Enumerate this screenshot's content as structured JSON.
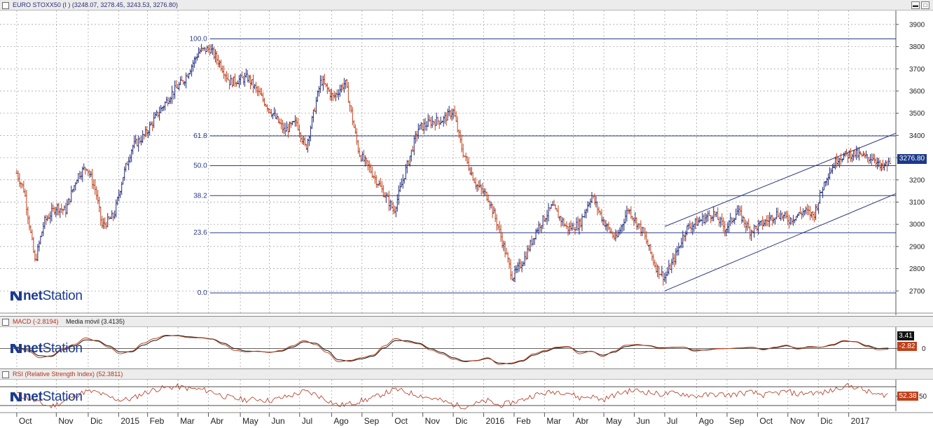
{
  "price_panel": {
    "title": "EURO STOXX50 (I ) (3248.07, 3278.45, 3243.53, 3276.80)",
    "last_value": "3276.80",
    "brand_prefix": "net",
    "brand_suffix": "Station"
  },
  "macd_panel": {
    "title": "MACD (-2.8194)",
    "subtitle": "Media móvil (3.4135)",
    "signal_value": "3.41",
    "macd_value": "-2.82"
  },
  "rsi_panel": {
    "title": "RSI (Relative Strength Index) (52.3811)",
    "rsi_value": "52.38"
  },
  "window_buttons": {
    "minimize": "▬",
    "maximize": "□"
  },
  "colors": {
    "up": "#1f2a7a",
    "down": "#c0401a",
    "grid": "#9a9a9a",
    "level_line": "#2c3a86",
    "signal_line": "#111111",
    "macd_line": "#c0401a",
    "rsi_line": "#b4331c",
    "last_price_box": "#1c3a8a"
  },
  "chart_data": [
    {
      "type": "line",
      "name_series": "EURO STOXX50 weekly OHLC",
      "ylim": [
        2600,
        3950
      ],
      "y_ticks": [
        2700,
        2800,
        2900,
        3000,
        3100,
        3200,
        3300,
        3400,
        3500,
        3600,
        3700,
        3800,
        3900
      ],
      "x_labels": [
        "Oct",
        "Nov",
        "Dic",
        "2015",
        "Feb",
        "Mar",
        "Abr",
        "May",
        "Jun",
        "Jul",
        "Ago",
        "Sep",
        "Oct",
        "Nov",
        "Dic",
        "2016",
        "Feb",
        "Mar",
        "Abr",
        "May",
        "Jun",
        "Jul",
        "Ago",
        "Sep",
        "Oct",
        "Nov",
        "Dic",
        "2017"
      ],
      "x_positions": [
        0,
        1.3,
        2.35,
        3.35,
        4.3,
        5.3,
        6.3,
        7.35,
        8.3,
        9.3,
        10.35,
        11.35,
        12.35,
        13.35,
        14.35,
        15.35,
        16.35,
        17.35,
        18.3,
        19.3,
        20.3,
        21.3,
        22.35,
        23.35,
        24.35,
        25.35,
        26.35,
        27.35
      ],
      "x_range": [
        -0.55,
        28.9
      ],
      "anchors": [
        [
          0.0,
          3230
        ],
        [
          0.25,
          3150
        ],
        [
          0.6,
          2830
        ],
        [
          0.9,
          3010
        ],
        [
          1.3,
          3080
        ],
        [
          1.6,
          3060
        ],
        [
          2.0,
          3220
        ],
        [
          2.3,
          3260
        ],
        [
          2.6,
          3150
        ],
        [
          2.8,
          2990
        ],
        [
          3.2,
          3040
        ],
        [
          3.5,
          3220
        ],
        [
          3.8,
          3350
        ],
        [
          4.2,
          3400
        ],
        [
          4.6,
          3490
        ],
        [
          5.1,
          3590
        ],
        [
          5.5,
          3650
        ],
        [
          6.0,
          3780
        ],
        [
          6.35,
          3790
        ],
        [
          6.7,
          3720
        ],
        [
          7.0,
          3640
        ],
        [
          7.6,
          3660
        ],
        [
          8.1,
          3560
        ],
        [
          8.8,
          3420
        ],
        [
          9.2,
          3460
        ],
        [
          9.5,
          3340
        ],
        [
          10.0,
          3650
        ],
        [
          10.4,
          3570
        ],
        [
          10.8,
          3640
        ],
        [
          11.25,
          3320
        ],
        [
          11.6,
          3250
        ],
        [
          11.9,
          3180
        ],
        [
          12.4,
          3060
        ],
        [
          12.8,
          3250
        ],
        [
          13.2,
          3430
        ],
        [
          13.6,
          3460
        ],
        [
          14.0,
          3470
        ],
        [
          14.35,
          3510
        ],
        [
          14.65,
          3330
        ],
        [
          15.1,
          3180
        ],
        [
          15.5,
          3120
        ],
        [
          15.8,
          3000
        ],
        [
          16.3,
          2760
        ],
        [
          16.7,
          2850
        ],
        [
          17.1,
          2980
        ],
        [
          17.6,
          3080
        ],
        [
          18.1,
          2980
        ],
        [
          18.5,
          3000
        ],
        [
          18.9,
          3130
        ],
        [
          19.3,
          3010
        ],
        [
          19.7,
          2930
        ],
        [
          20.1,
          3070
        ],
        [
          20.6,
          2960
        ],
        [
          21.0,
          2810
        ],
        [
          21.3,
          2760
        ],
        [
          21.6,
          2840
        ],
        [
          22.0,
          2980
        ],
        [
          22.5,
          3020
        ],
        [
          22.9,
          3050
        ],
        [
          23.3,
          2980
        ],
        [
          23.7,
          3060
        ],
        [
          24.1,
          2970
        ],
        [
          24.6,
          3010
        ],
        [
          25.0,
          3050
        ],
        [
          25.4,
          3020
        ],
        [
          25.9,
          3060
        ],
        [
          26.2,
          3040
        ],
        [
          26.6,
          3210
        ],
        [
          27.0,
          3300
        ],
        [
          27.5,
          3320
        ],
        [
          27.9,
          3300
        ],
        [
          28.2,
          3300
        ],
        [
          28.4,
          3250
        ],
        [
          28.7,
          3276
        ]
      ],
      "fib_levels": [
        {
          "label": "100.0",
          "value": 3835
        },
        {
          "label": "61.8",
          "value": 3398
        },
        {
          "label": "50.0",
          "value": 3264
        },
        {
          "label": "38.2",
          "value": 3129
        },
        {
          "label": "23.6",
          "value": 2962
        },
        {
          "label": "0.0",
          "value": 2691
        }
      ],
      "fib_x_start": 6.35,
      "channel": [
        {
          "x1": 21.3,
          "y1": 2990,
          "x2": 28.9,
          "y2": 3410
        },
        {
          "x1": 21.3,
          "y1": 2700,
          "x2": 28.9,
          "y2": 3138
        }
      ]
    },
    {
      "type": "line",
      "name_series": "MACD and Media móvil",
      "ylim": [
        -140,
        140
      ],
      "y_ticks": [
        0
      ],
      "series": [
        {
          "label": "MACD",
          "values": [
            5,
            -20,
            -70,
            -55,
            0,
            30,
            80,
            55,
            10,
            -40,
            -20,
            40,
            75,
            100,
            95,
            82,
            80,
            70,
            30,
            -15,
            -25,
            -20,
            -30,
            -15,
            20,
            60,
            30,
            -30,
            -100,
            -90,
            -70,
            -50,
            20,
            75,
            50,
            35,
            -10,
            -40,
            -80,
            -100,
            -90,
            -70,
            -120,
            -110,
            -90,
            -40,
            -15,
            10,
            15,
            -40,
            -20,
            -60,
            -20,
            25,
            30,
            20,
            0,
            10,
            10,
            -20,
            -10,
            0,
            0,
            5,
            10,
            -10,
            10,
            25,
            -5,
            15,
            10,
            30,
            60,
            50,
            15,
            -10,
            -5
          ]
        },
        {
          "label": "Media móvil",
          "values": [
            10,
            -10,
            -55,
            -60,
            -10,
            20,
            65,
            60,
            20,
            -25,
            -25,
            25,
            60,
            95,
            98,
            88,
            82,
            72,
            40,
            0,
            -20,
            -22,
            -28,
            -20,
            10,
            50,
            40,
            -15,
            -85,
            -95,
            -78,
            -58,
            5,
            60,
            58,
            40,
            0,
            -30,
            -70,
            -95,
            -92,
            -75,
            -110,
            -115,
            -95,
            -50,
            -22,
            5,
            12,
            -25,
            -22,
            -50,
            -28,
            15,
            26,
            22,
            5,
            8,
            10,
            -12,
            -12,
            -2,
            0,
            3,
            8,
            -5,
            6,
            20,
            2,
            10,
            10,
            25,
            55,
            52,
            22,
            0,
            3
          ]
        }
      ]
    },
    {
      "type": "line",
      "name_series": "RSI",
      "ylim": [
        18,
        82
      ],
      "y_ticks": [
        50
      ],
      "guides": [
        30,
        70
      ],
      "values": [
        55,
        45,
        35,
        28,
        38,
        50,
        60,
        58,
        48,
        42,
        44,
        56,
        64,
        68,
        70,
        66,
        64,
        60,
        50,
        45,
        42,
        44,
        40,
        46,
        52,
        60,
        54,
        42,
        30,
        34,
        40,
        46,
        56,
        64,
        58,
        52,
        46,
        40,
        32,
        28,
        34,
        40,
        30,
        36,
        42,
        52,
        56,
        60,
        58,
        46,
        50,
        42,
        52,
        60,
        62,
        58,
        54,
        56,
        55,
        50,
        52,
        54,
        52,
        56,
        58,
        52,
        56,
        60,
        54,
        58,
        56,
        62,
        72,
        70,
        60,
        52,
        54
      ]
    }
  ]
}
